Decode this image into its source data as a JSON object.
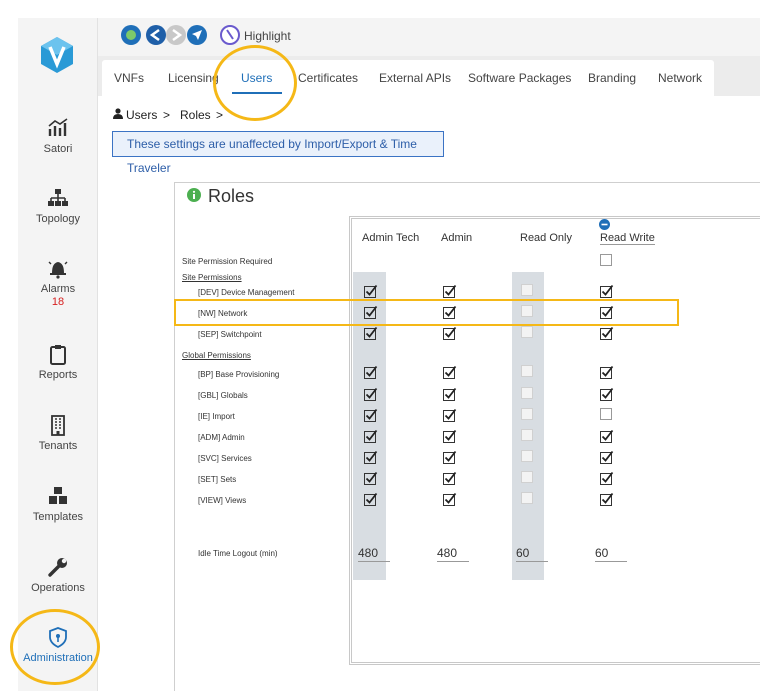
{
  "sidebar": {
    "items": [
      {
        "label": "Satori",
        "icon": "chart-icon"
      },
      {
        "label": "Topology",
        "icon": "topology-icon"
      },
      {
        "label": "Alarms",
        "icon": "bell-icon",
        "badge": "18"
      },
      {
        "label": "Reports",
        "icon": "clipboard-icon"
      },
      {
        "label": "Tenants",
        "icon": "building-icon"
      },
      {
        "label": "Templates",
        "icon": "cubes-icon"
      },
      {
        "label": "Operations",
        "icon": "wrench-icon"
      },
      {
        "label": "Administration",
        "icon": "shield-icon"
      }
    ]
  },
  "topbar": {
    "highlight_label": "Highlight"
  },
  "tabs": [
    "VNFs",
    "Licensing",
    "Users",
    "Certificates",
    "External APIs",
    "Software Packages",
    "Branding",
    "Network"
  ],
  "active_tab": "Users",
  "breadcrumb": {
    "users": "Users",
    "roles": "Roles",
    "sep": ">"
  },
  "banner": "These settings are unaffected by Import/Export & Time Traveler",
  "roles": {
    "title": "Roles",
    "columns": [
      "Admin Tech",
      "Admin",
      "Read Only",
      "Read Write"
    ],
    "site_permission_required": "Site Permission Required",
    "site_permissions_header": "Site Permissions",
    "global_permissions_header": "Global Permissions",
    "site_permissions": [
      "[DEV] Device Management",
      "[NW] Network",
      "[SEP] Switchpoint"
    ],
    "global_permissions": [
      "[BP] Base Provisioning",
      "[GBL] Globals",
      "[IE] Import",
      "[ADM] Admin",
      "[SVC] Services",
      "[SET] Sets",
      "[VIEW] Views"
    ],
    "idle_label": "Idle Time Logout (min)",
    "idle_values": [
      "480",
      "480",
      "60",
      "60"
    ],
    "checks": {
      "site_required": [
        "none",
        "none",
        "none",
        "empty"
      ],
      "site": [
        [
          "check",
          "check",
          "dim",
          "check"
        ],
        [
          "check",
          "check",
          "dim",
          "check"
        ],
        [
          "check",
          "check",
          "dim",
          "check"
        ]
      ],
      "global": [
        [
          "check",
          "check",
          "dim",
          "check"
        ],
        [
          "check",
          "check",
          "dim",
          "check"
        ],
        [
          "check",
          "check",
          "dim",
          "empty"
        ],
        [
          "check",
          "check",
          "dim",
          "check"
        ],
        [
          "check",
          "check",
          "dim",
          "check"
        ],
        [
          "check",
          "check",
          "dim",
          "check"
        ],
        [
          "check",
          "check",
          "dim",
          "check"
        ]
      ]
    }
  },
  "colors": {
    "accent": "#1f6fb8",
    "highlight": "#f5b817",
    "alarm": "#d62020"
  }
}
